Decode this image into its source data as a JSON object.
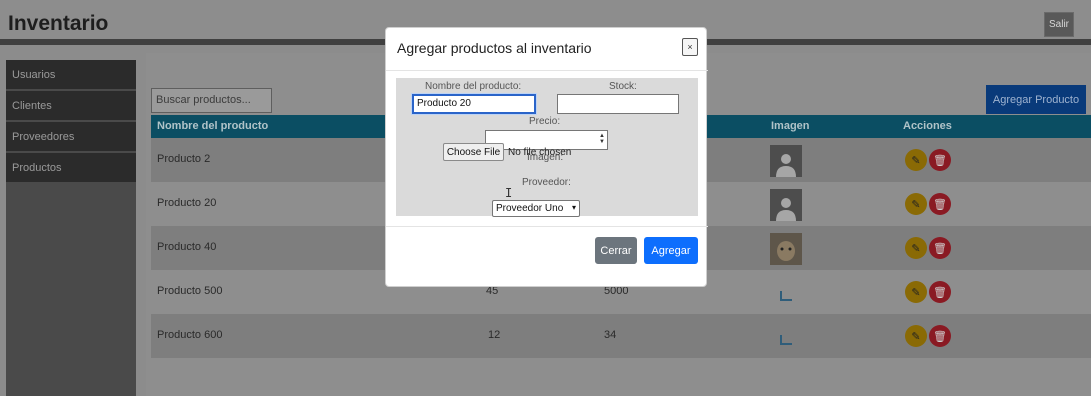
{
  "header": {
    "brand": "Inventario",
    "logout_label": "Salir"
  },
  "sidebar": {
    "items": [
      {
        "label": "Usuarios"
      },
      {
        "label": "Clientes"
      },
      {
        "label": "Proveedores"
      },
      {
        "label": "Productos"
      }
    ]
  },
  "toolbar": {
    "search_placeholder": "Buscar productos...",
    "add_label": "Agregar Producto"
  },
  "table": {
    "headers": {
      "name": "Nombre del producto",
      "image": "Imagen",
      "actions": "Acciones"
    },
    "rows": [
      {
        "name": "Producto 2",
        "stock": "",
        "price": "",
        "image": "avatar"
      },
      {
        "name": "Producto 20",
        "stock": "",
        "price": "",
        "image": "avatar"
      },
      {
        "name": "Producto 40",
        "stock": "",
        "price": "",
        "image": "photo"
      },
      {
        "name": "Producto 500",
        "stock": "45",
        "price": "5000",
        "image": "broken"
      },
      {
        "name": "Producto 600",
        "stock": "12",
        "price": "34",
        "image": "broken"
      }
    ]
  },
  "modal": {
    "title": "Agregar productos al inventario",
    "close_label": "×",
    "name_label": "Nombre del producto:",
    "name_value": "Producto 20",
    "stock_label": "Stock:",
    "stock_value": "",
    "price_label": "Precio:",
    "price_value": "",
    "image_label": "Imagen:",
    "file_button": "Choose File",
    "file_status": "No file chosen",
    "supplier_label": "Proveedor:",
    "supplier_selected": "Proveedor Uno",
    "cancel_label": "Cerrar",
    "submit_label": "Agregar"
  }
}
